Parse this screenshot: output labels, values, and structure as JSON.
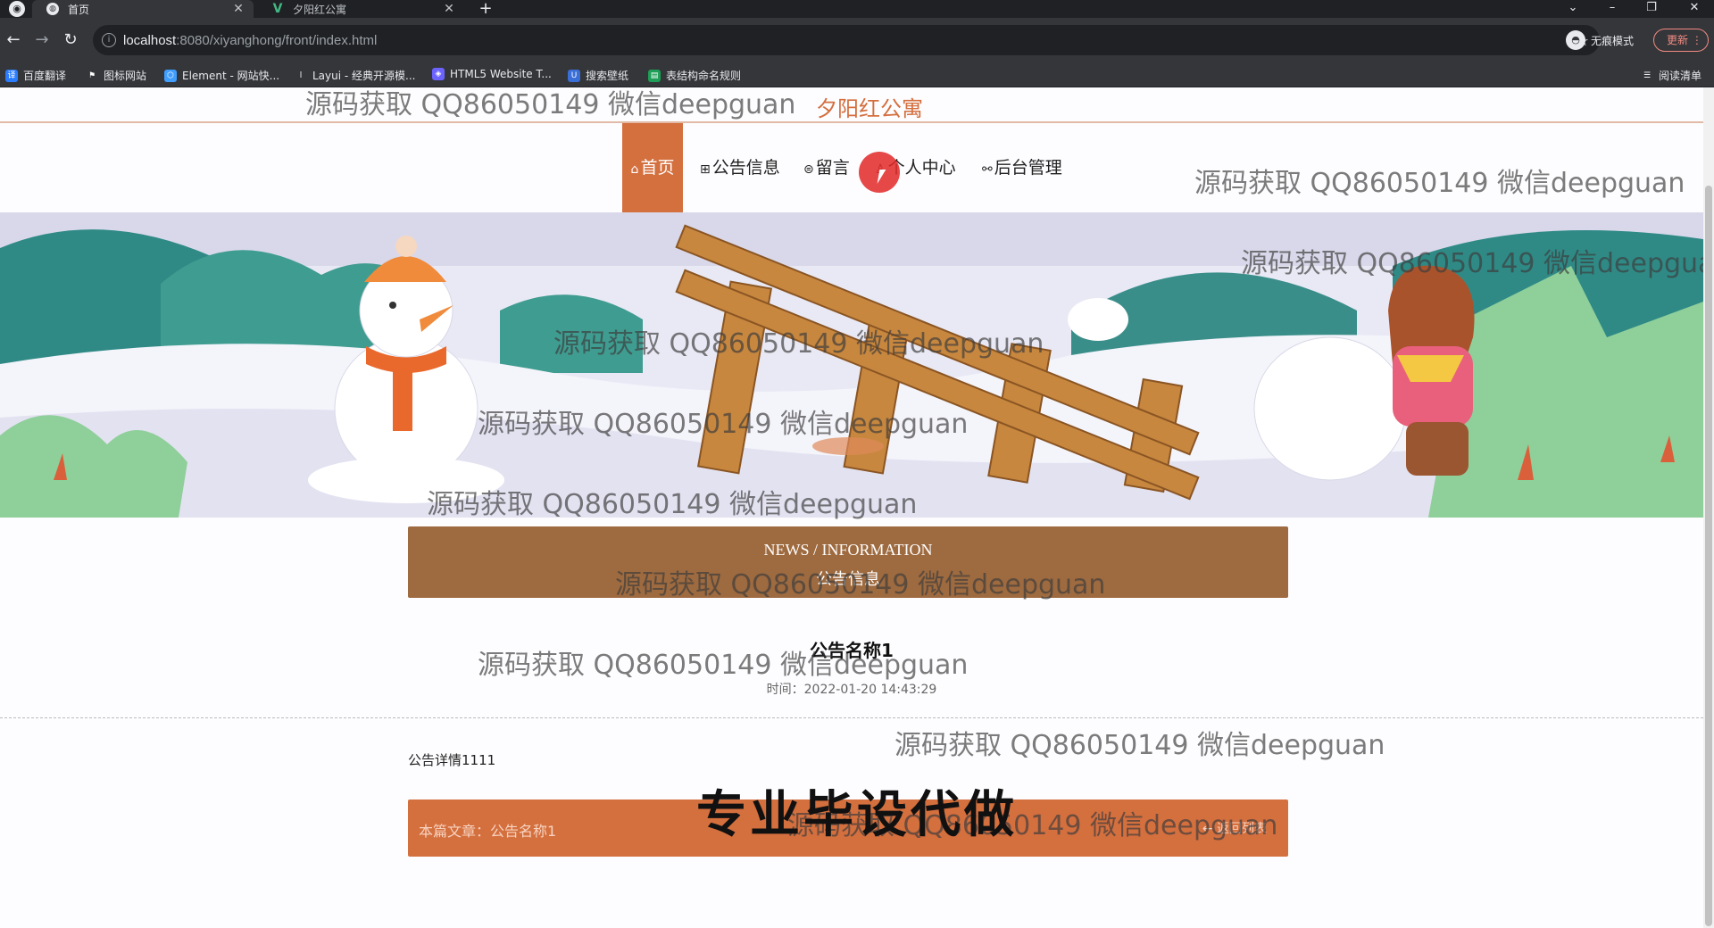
{
  "browser": {
    "tabs": [
      {
        "title": "首页",
        "active": true
      },
      {
        "title": "夕阳红公寓",
        "active": false
      }
    ],
    "new_tab": "+",
    "url_host": "localhost",
    "url_rest": ":8080/xiyanghong/front/index.html",
    "incognito_label": "无痕模式",
    "update_label": "更新",
    "bookmarks": [
      {
        "label": "百度翻译",
        "icon": "baidu-translate-icon",
        "color": "#2b7cff"
      },
      {
        "label": "图标网站",
        "icon": "flag-icon",
        "color": "#555555"
      },
      {
        "label": "Element - 网站快...",
        "icon": "element-icon",
        "color": "#409eff"
      },
      {
        "label": "Layui - 经典开源模...",
        "icon": "layui-icon",
        "color": "#555555"
      },
      {
        "label": "HTML5 Website T...",
        "icon": "html5-icon",
        "color": "#6c63ff"
      },
      {
        "label": "搜索壁纸",
        "icon": "wallpaper-icon",
        "color": "#3a6fd8"
      },
      {
        "label": "表结构命名规则",
        "icon": "sheet-icon",
        "color": "#1e9e57"
      }
    ],
    "reading_list": "阅读清单"
  },
  "site": {
    "title": "夕阳红公寓",
    "nav": [
      {
        "label": "首页",
        "icon": "home-icon",
        "active": true
      },
      {
        "label": "公告信息",
        "icon": "grid-icon",
        "active": false
      },
      {
        "label": "留言",
        "icon": "message-icon",
        "active": false
      },
      {
        "label": "个人中心",
        "icon": "user-icon",
        "active": false
      },
      {
        "label": "后台管理",
        "icon": "link-icon",
        "active": false
      }
    ],
    "icons": {
      "home": "⌂",
      "grid": "⊞",
      "message": "⊜",
      "user": "♙",
      "link": "⚯"
    }
  },
  "news": {
    "header_en": "NEWS / INFORMATION",
    "header_cn": "公告信息",
    "title": "公告名称1",
    "time": "时间：2022-01-20 14:43:29",
    "content": "公告详情1111",
    "footer_current": "本篇文章：公告名称1",
    "footer_back": "← 返回列表"
  },
  "slogan": "专业毕设代做",
  "watermark": "源码获取 QQ86050149 微信deepguan",
  "colors": {
    "brand": "#d46f3e",
    "news_header": "#9e6a3f"
  }
}
